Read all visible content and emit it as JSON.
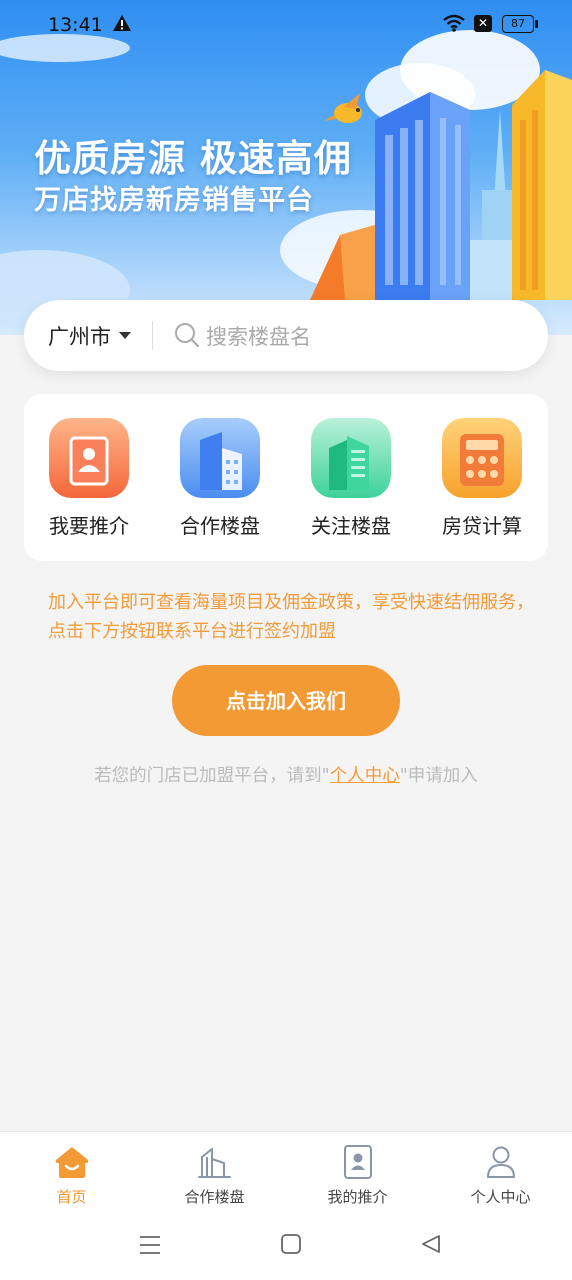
{
  "status_bar": {
    "time": "13:41",
    "battery": "87"
  },
  "banner": {
    "title": "优质房源 极速高佣",
    "subtitle": "万店找房新房销售平台"
  },
  "search": {
    "city": "广州市",
    "placeholder": "搜索楼盘名",
    "value": ""
  },
  "quick_menu": {
    "items": [
      {
        "label": "我要推介",
        "icon": "referral-card-icon"
      },
      {
        "label": "合作楼盘",
        "icon": "building-icon"
      },
      {
        "label": "关注楼盘",
        "icon": "followed-building-icon"
      },
      {
        "label": "房贷计算",
        "icon": "calculator-icon"
      }
    ]
  },
  "promo": {
    "text": "加入平台即可查看海量项目及佣金政策，享受快速结佣服务，点击下方按钮联系平台进行签约加盟",
    "button_label": "点击加入我们",
    "hint_prefix": "若您的门店已加盟平台，请到\"",
    "hint_link": "个人中心",
    "hint_suffix": "\"申请加入"
  },
  "bottom_nav": {
    "items": [
      {
        "label": "首页",
        "icon": "home-icon",
        "active": true
      },
      {
        "label": "合作楼盘",
        "icon": "buildings-icon",
        "active": false
      },
      {
        "label": "我的推介",
        "icon": "referral-icon",
        "active": false
      },
      {
        "label": "个人中心",
        "icon": "user-icon",
        "active": false
      }
    ]
  },
  "colors": {
    "accent": "#f39a35",
    "banner_blue": "#2f8ef2",
    "hint_gray": "#bbbbbb"
  }
}
